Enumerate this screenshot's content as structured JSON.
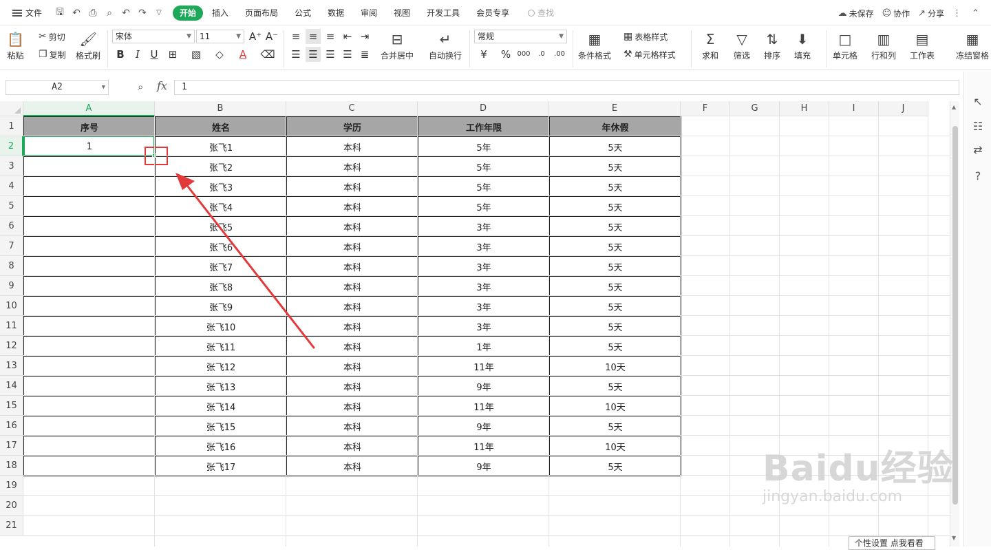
{
  "menubar": {
    "file_label": "文件",
    "tabs": [
      "开始",
      "插入",
      "页面布局",
      "公式",
      "数据",
      "审阅",
      "视图",
      "开发工具",
      "会员专享"
    ],
    "active_tab": "开始",
    "search_placeholder": "查找",
    "unsaved_label": "未保存",
    "collab_label": "协作",
    "share_label": "分享"
  },
  "ribbon": {
    "paste": "粘贴",
    "cut": "剪切",
    "copy": "复制",
    "format_painter": "格式刷",
    "font_name": "宋体",
    "font_size": "11",
    "merge_center": "合并居中",
    "wrap_text": "自动换行",
    "number_format": "常规",
    "conditional_format": "条件格式",
    "table_style": "表格样式",
    "cell_style": "单元格样式",
    "sum": "求和",
    "filter": "筛选",
    "sort": "排序",
    "fill": "填充",
    "cell": "单元格",
    "row_col": "行和列",
    "worksheet": "工作表",
    "freeze": "冻结窗格"
  },
  "formula_bar": {
    "cell_ref": "A2",
    "fx": "fx",
    "value": "1"
  },
  "grid": {
    "columns": [
      "A",
      "B",
      "C",
      "D",
      "E",
      "F",
      "G",
      "H",
      "I",
      "J"
    ],
    "rows": [
      "1",
      "2",
      "3",
      "4",
      "5",
      "6",
      "7",
      "8",
      "9",
      "10",
      "11",
      "12",
      "13",
      "14",
      "15",
      "16",
      "17",
      "18",
      "19",
      "20",
      "21"
    ],
    "selected_cell": "A2",
    "header": [
      "序号",
      "姓名",
      "学历",
      "工作年限",
      "年休假"
    ],
    "records": [
      [
        "1",
        "张飞1",
        "本科",
        "5年",
        "5天"
      ],
      [
        "",
        "张飞2",
        "本科",
        "5年",
        "5天"
      ],
      [
        "",
        "张飞3",
        "本科",
        "5年",
        "5天"
      ],
      [
        "",
        "张飞4",
        "本科",
        "5年",
        "5天"
      ],
      [
        "",
        "张飞5",
        "本科",
        "3年",
        "5天"
      ],
      [
        "",
        "张飞6",
        "本科",
        "3年",
        "5天"
      ],
      [
        "",
        "张飞7",
        "本科",
        "3年",
        "5天"
      ],
      [
        "",
        "张飞8",
        "本科",
        "3年",
        "5天"
      ],
      [
        "",
        "张飞9",
        "本科",
        "3年",
        "5天"
      ],
      [
        "",
        "张飞10",
        "本科",
        "3年",
        "5天"
      ],
      [
        "",
        "张飞11",
        "本科",
        "1年",
        "5天"
      ],
      [
        "",
        "张飞12",
        "本科",
        "11年",
        "10天"
      ],
      [
        "",
        "张飞13",
        "本科",
        "9年",
        "5天"
      ],
      [
        "",
        "张飞14",
        "本科",
        "11年",
        "10天"
      ],
      [
        "",
        "张飞15",
        "本科",
        "9年",
        "5天"
      ],
      [
        "",
        "张飞16",
        "本科",
        "11年",
        "10天"
      ],
      [
        "",
        "张飞17",
        "本科",
        "9年",
        "5天"
      ]
    ]
  },
  "tooltip": "个性设置   点我看看",
  "watermark": {
    "logo": "Baidu经验",
    "url": "jingyan.baidu.com"
  },
  "colors": {
    "accent": "#1ea85a",
    "annotation": "#e23a3a",
    "header_fill": "#a6a6a6"
  }
}
